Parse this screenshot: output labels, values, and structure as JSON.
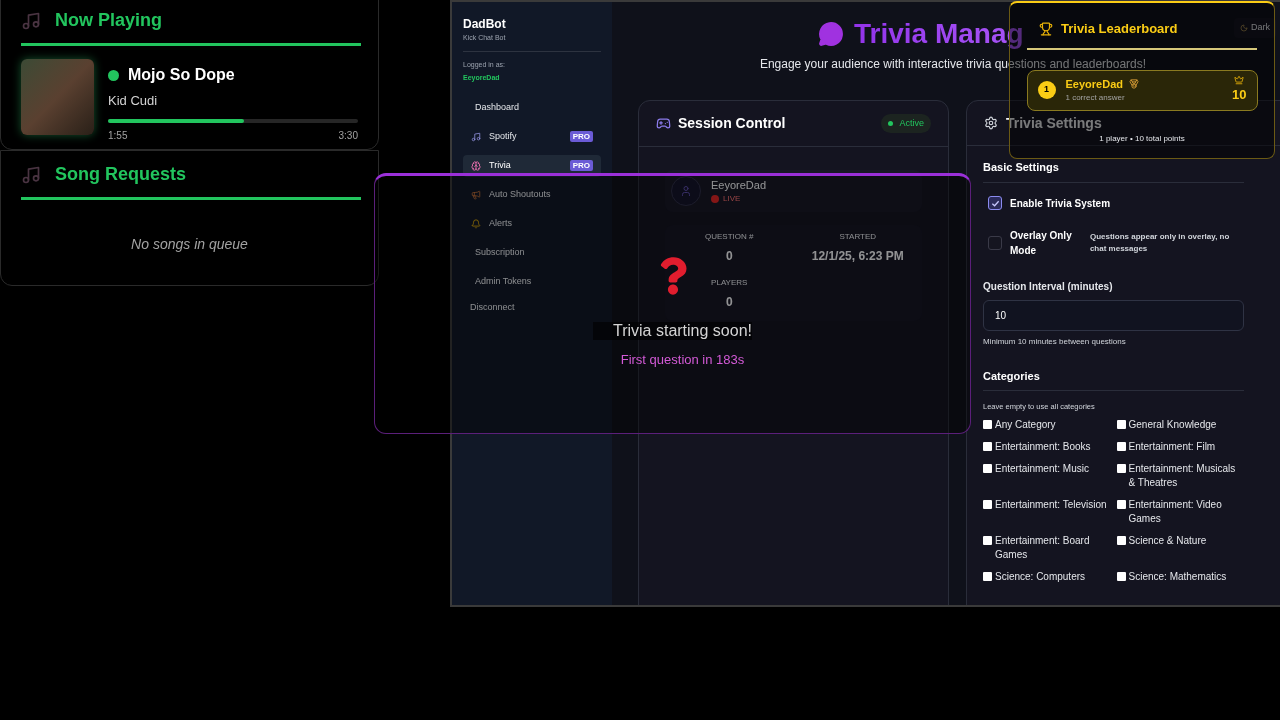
{
  "now_playing": {
    "title": "Now Playing",
    "track": "Mojo So Dope",
    "artist": "Kid Cudi",
    "playing": true,
    "level": 0.544,
    "elapsed": "1:55",
    "duration": "3:30"
  },
  "song_requests": {
    "title": "Song Requests",
    "empty_text": "No songs in queue"
  },
  "sidebar": {
    "brand": "DadBot",
    "tagline": "Kick Chat Bot",
    "logged_in_label": "Logged in as:",
    "username": "EeyoreDad",
    "items": [
      {
        "label": "Dashboard",
        "selected": false
      },
      {
        "label": "Spotify",
        "badge": "PRO",
        "selected": false
      },
      {
        "label": "Trivia",
        "badge": "PRO",
        "selected": true
      },
      {
        "label": "Auto Shoutouts",
        "selected": false
      },
      {
        "label": "Alerts",
        "selected": false
      },
      {
        "label": "Subscription",
        "selected": false
      },
      {
        "label": "Admin Tokens",
        "selected": false
      }
    ],
    "disconnect": "Disconnect"
  },
  "header": {
    "title": "Trivia Manag",
    "subtitle": "Engage your audience with interactive trivia questions and leaderboards!",
    "theme_toggle": "Dark"
  },
  "session_control": {
    "title": "Session Control",
    "status": "Active",
    "user": "EeyoreDad",
    "live": "LIVE",
    "stats": [
      {
        "label": "QUESTION #",
        "value": "0"
      },
      {
        "label": "STARTED",
        "value": "12/1/25, 6:23 PM"
      },
      {
        "label": "PLAYERS",
        "value": "0"
      }
    ]
  },
  "trivia_settings": {
    "title": "Trivia Settings",
    "basic_heading": "Basic Settings",
    "options": [
      {
        "label": "Enable Trivia System",
        "checked": true
      },
      {
        "label": "Overlay Only Mode",
        "checked": false,
        "note": "Questions appear only in overlay, no chat messages"
      }
    ],
    "interval_label": "Question Interval (minutes)",
    "interval_value": "10",
    "interval_hint": "Minimum 10 minutes between questions",
    "categories_heading": "Categories",
    "categories_hint": "Leave empty to use all categories",
    "categories": [
      {
        "label": "Any Category",
        "checked": false
      },
      {
        "label": "General Knowledge",
        "checked": false
      },
      {
        "label": "Entertainment: Books",
        "checked": false
      },
      {
        "label": "Entertainment: Film",
        "checked": false
      },
      {
        "label": "Entertainment: Music",
        "checked": false
      },
      {
        "label": "Entertainment: Musicals & Theatres",
        "checked": false
      },
      {
        "label": "Entertainment: Television",
        "checked": false
      },
      {
        "label": "Entertainment: Video Games",
        "checked": false
      },
      {
        "label": "Entertainment: Board Games",
        "checked": false
      },
      {
        "label": "Science & Nature",
        "checked": false
      },
      {
        "label": "Science: Computers",
        "checked": false
      },
      {
        "label": "Science: Mathematics",
        "checked": false
      }
    ]
  },
  "trivia_overlay": {
    "message": "Trivia starting soon!",
    "countdown": "First question in 183s"
  },
  "leaderboard": {
    "title": "Trivia Leaderboard",
    "entries": [
      {
        "rank": "1",
        "name": "EeyoreDad",
        "detail": "1 correct answer",
        "points": "10"
      }
    ],
    "footer": "1 player • 10 total points"
  }
}
